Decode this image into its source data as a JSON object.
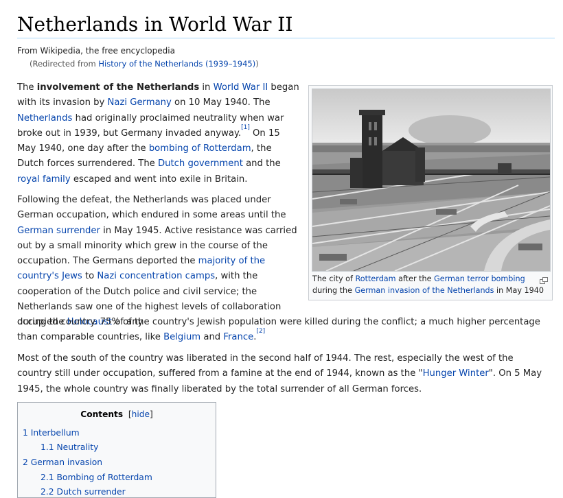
{
  "page": {
    "title": "Netherlands in World War II",
    "site_sub": "From Wikipedia, the free encyclopedia",
    "redirect_prefix": "(Redirected from ",
    "redirect_link": "History of the Netherlands (1939–1945)",
    "redirect_suffix": ")"
  },
  "p1": {
    "t1": "The ",
    "b1": "involvement of the Netherlands",
    "t2": " in ",
    "l1": "World War II",
    "t3": " began with its invasion by ",
    "l2": "Nazi Germany",
    "t4": " on 10 May 1940. The ",
    "l3": "Netherlands",
    "t5": " had originally proclaimed neutrality when war broke out in 1939, but Germany invaded anyway.",
    "ref1": "[1]",
    "t6": " On 15 May 1940, one day after the ",
    "l4": "bombing of Rotterdam",
    "t7": ", the Dutch forces surrendered. The ",
    "l5": "Dutch government",
    "t8": " and the ",
    "l6": "royal family",
    "t9": " escaped and went into exile in Britain."
  },
  "p2": {
    "t1": "Following the defeat, the Netherlands was placed under German occupation, which endured in some areas until the ",
    "l1": "German surrender",
    "t2": " in May 1945. Active resistance was carried out by a small minority which grew in the course of the occupation. The Germans deported the ",
    "l2": "majority of the country's Jews",
    "t3": " to ",
    "l3": "Nazi concentration camps",
    "t4": ", with the cooperation of the Dutch police and civil service; the Netherlands saw one of the highest levels of collaboration during the ",
    "l4": "Holocaust",
    "t5": " of any",
    "t6": "occupied country. 75% of the country's Jewish population were killed during the conflict; a much higher percentage than comparable countries, like ",
    "l5": "Belgium",
    "t7": " and ",
    "l6": "France",
    "t8": ".",
    "ref2": "[2]"
  },
  "p3": {
    "t1": "Most of the south of the country was liberated in the second half of 1944. The rest, especially the west of the country still under occupation, suffered from a famine at the end of 1944, known as the \"",
    "l1": "Hunger Winter",
    "t2": "\". On 5 May 1945, the whole country was finally liberated by the total surrender of all German forces."
  },
  "thumb": {
    "c1": "The city of ",
    "l1": "Rotterdam",
    "c2": " after the ",
    "l2": "German terror bombing",
    "c3": " during the ",
    "l3": "German invasion of the Netherlands",
    "c4": " in May 1940"
  },
  "toc": {
    "title": "Contents",
    "lb": "[",
    "hide": "hide",
    "rb": "]",
    "items": [
      {
        "num": "1",
        "text": "Interbellum"
      },
      {
        "num": "1.1",
        "text": "Neutrality"
      },
      {
        "num": "2",
        "text": "German invasion"
      },
      {
        "num": "2.1",
        "text": "Bombing of Rotterdam"
      },
      {
        "num": "2.2",
        "text": "Dutch surrender"
      }
    ]
  },
  "colors": {
    "link": "#0645ad",
    "text": "#222222",
    "toc_bg": "#f8f9fa"
  }
}
